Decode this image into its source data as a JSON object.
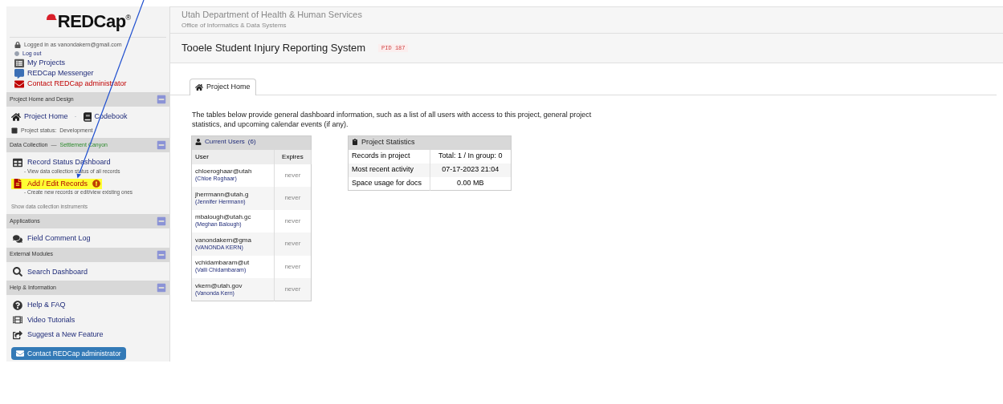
{
  "sidebar": {
    "logo": "REDCap",
    "logo_mark": "®",
    "login_text": "Logged in as vanondakern@gmail.com",
    "logout": "Log out",
    "links": [
      {
        "label": "My Projects",
        "kind": "projects"
      },
      {
        "label": "REDCap Messenger",
        "kind": "messenger"
      },
      {
        "label": "Contact REDCap administrator",
        "kind": "contact"
      }
    ],
    "sections": [
      {
        "title": "Project Home and Design",
        "expanded": true,
        "items": [
          {
            "kind": "pair",
            "label": "Project Home",
            "separator": "·",
            "label2": "Codebook"
          },
          {
            "kind": "status",
            "label": "Project status:  Development"
          }
        ]
      },
      {
        "title": "Data Collection",
        "dash": "—",
        "subtitle": "Settlement Canyon",
        "expanded": true,
        "items": [
          {
            "kind": "dashboard",
            "label": "Record Status Dashboard",
            "note": "- View data collection status of all records",
            "highlighted": false
          },
          {
            "kind": "records",
            "label": "Add / Edit Records",
            "note": "- Create new records or edit/view existing ones",
            "highlighted": true
          },
          {
            "kind": "plain",
            "label": "Show data collection instruments"
          }
        ]
      },
      {
        "title": "Applications",
        "expanded": true,
        "items": [
          {
            "kind": "comments",
            "label": "Field Comment Log"
          }
        ]
      },
      {
        "title": "External Modules",
        "expanded": true,
        "items": [
          {
            "kind": "search",
            "label": "Search Dashboard"
          }
        ]
      },
      {
        "title": "Help & Information",
        "expanded": true,
        "items": [
          {
            "kind": "help",
            "label": "Help & FAQ"
          },
          {
            "kind": "video",
            "label": "Video Tutorials"
          },
          {
            "kind": "suggest",
            "label": "Suggest a New Feature"
          }
        ]
      }
    ],
    "contact_button": "Contact REDCap administrator"
  },
  "header": {
    "org": "Utah Department of Health & Human Services",
    "office": "Office of Informatics & Data Systems",
    "project_title": "Tooele Student Injury Reporting System",
    "pid": "PID 187"
  },
  "tabs": [
    {
      "label": "Project Home",
      "selected": true
    }
  ],
  "intro": "The tables below provide general dashboard information, such as a list of all users with access to this project, general project statistics, and upcoming calendar events (if any).",
  "users": {
    "title": "Current Users",
    "count": "(6)",
    "columns": [
      "User",
      "Expires"
    ],
    "rows": [
      {
        "email": "chloeroghaar@utah",
        "name": "(Chloe Roghaar)",
        "expires": "never"
      },
      {
        "email": "jherrmann@utah.g",
        "name": "(Jennifer Herrmann)",
        "expires": "never"
      },
      {
        "email": "mbalough@utah.gc",
        "name": "(Meghan Balough)",
        "expires": "never"
      },
      {
        "email": "vanondakern@gma",
        "name": "(VANONDA KERN)",
        "expires": "never"
      },
      {
        "email": "vchidambaram@ut",
        "name": "(Valli Chidambaram)",
        "expires": "never"
      },
      {
        "email": "vkern@utah.gov",
        "name": "(Vanonda Kern)",
        "expires": "never"
      }
    ]
  },
  "stats": {
    "title": "Project Statistics",
    "rows": [
      {
        "label": "Records in project",
        "value": "Total: 1 / In group: 0"
      },
      {
        "label": "Most recent activity",
        "value": "07-17-2023 21:04"
      },
      {
        "label": "Space usage for docs",
        "value": "0.00 MB"
      }
    ]
  }
}
